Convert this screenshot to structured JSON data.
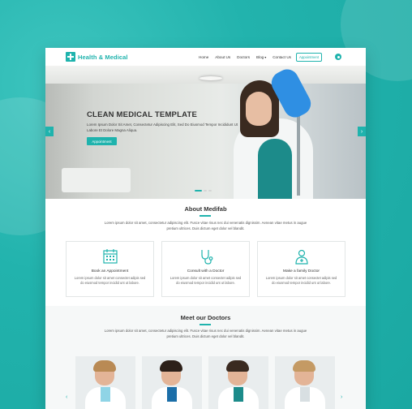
{
  "colors": {
    "accent": "#1fb3ad",
    "background": "#22b3ad",
    "text": "#333333"
  },
  "header": {
    "logo_text": "Health & Medical",
    "nav": [
      {
        "label": "Home"
      },
      {
        "label": "About Us"
      },
      {
        "label": "Doctors"
      },
      {
        "label": "Blog"
      },
      {
        "label": "Contact Us"
      }
    ],
    "appointment_button": "Appointment",
    "settings_icon": "gear-icon"
  },
  "hero": {
    "title": "CLEAN MEDICAL TEMPLATE",
    "text": "Lorem Ipsum Dolor Sit Amet, Consectetur Adipiscing Elit, Sed Do Eiusmod Tempor Incididunt Ut Labore Et Dolore Magna Aliqua.",
    "button": "Appointment",
    "prev_icon": "chevron-left-icon",
    "next_icon": "chevron-right-icon"
  },
  "about": {
    "title": "About Medifab",
    "text": "Lorem ipsum dolor sit amet, consectetur adipiscing elit. Fusce vitae risus nec dui venenatis dignissim. Aenean vitae metus in augue pretium ultrices. Duis dictum eget dolor vel blandit.",
    "cards": [
      {
        "icon": "calendar-icon",
        "title": "Book an Appointment",
        "text": "Lorem ipsum dolor sit amet consectet adipis sed do eiusmod tempor incidid unt ut labore."
      },
      {
        "icon": "stethoscope-icon",
        "title": "Consult with a Doctor",
        "text": "Lorem ipsum dolor sit amet consectet adipis sed do eiusmod tempor incidid unt ut labore."
      },
      {
        "icon": "doctor-icon",
        "title": "Make a family Doctor",
        "text": "Lorem ipsum dolor sit amet consectet adipis sed do eiusmod tempor incidid unt ut labore."
      }
    ]
  },
  "doctors": {
    "title": "Meet our Doctors",
    "text": "Lorem ipsum dolor sit amet, consectetur adipiscing elit. Fusce vitae risus nec dui venenatis dignissim. Aenean vitae metus in augue pretium ultrices. Duis dictum eget dolor vel blandit."
  }
}
